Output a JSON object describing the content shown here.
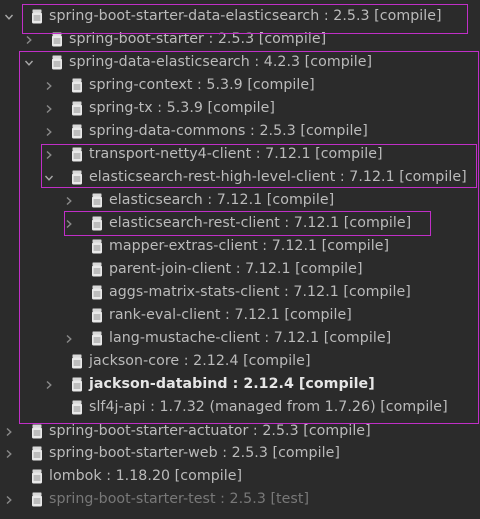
{
  "tree": [
    {
      "label": "spring-boot-starter-data-elasticsearch : 2.5.3 [compile]",
      "depth": 0,
      "arrow": "down",
      "style": "normal"
    },
    {
      "label": "spring-boot-starter : 2.5.3 [compile]",
      "depth": 1,
      "arrow": "right",
      "style": "normal"
    },
    {
      "label": "spring-data-elasticsearch : 4.2.3 [compile]",
      "depth": 1,
      "arrow": "down",
      "style": "normal"
    },
    {
      "label": "spring-context : 5.3.9 [compile]",
      "depth": 2,
      "arrow": "right",
      "style": "normal"
    },
    {
      "label": "spring-tx : 5.3.9 [compile]",
      "depth": 2,
      "arrow": "right",
      "style": "normal"
    },
    {
      "label": "spring-data-commons : 2.5.3 [compile]",
      "depth": 2,
      "arrow": "right",
      "style": "normal"
    },
    {
      "label": "transport-netty4-client : 7.12.1 [compile]",
      "depth": 2,
      "arrow": "right",
      "style": "normal"
    },
    {
      "label": "elasticsearch-rest-high-level-client : 7.12.1 [compile]",
      "depth": 2,
      "arrow": "down",
      "style": "normal"
    },
    {
      "label": "elasticsearch : 7.12.1 [compile]",
      "depth": 3,
      "arrow": "right",
      "style": "normal"
    },
    {
      "label": "elasticsearch-rest-client : 7.12.1 [compile]",
      "depth": 3,
      "arrow": "right",
      "style": "normal"
    },
    {
      "label": "mapper-extras-client : 7.12.1 [compile]",
      "depth": 3,
      "arrow": "none",
      "style": "normal"
    },
    {
      "label": "parent-join-client : 7.12.1 [compile]",
      "depth": 3,
      "arrow": "none",
      "style": "normal"
    },
    {
      "label": "aggs-matrix-stats-client : 7.12.1 [compile]",
      "depth": 3,
      "arrow": "none",
      "style": "normal"
    },
    {
      "label": "rank-eval-client : 7.12.1 [compile]",
      "depth": 3,
      "arrow": "none",
      "style": "normal"
    },
    {
      "label": "lang-mustache-client : 7.12.1 [compile]",
      "depth": 3,
      "arrow": "right",
      "style": "normal"
    },
    {
      "label": "jackson-core : 2.12.4 [compile]",
      "depth": 2,
      "arrow": "none",
      "style": "normal"
    },
    {
      "label": "jackson-databind : 2.12.4 [compile]",
      "depth": 2,
      "arrow": "right",
      "style": "bold"
    },
    {
      "label": "slf4j-api : 1.7.32 (managed from 1.7.26) [compile]",
      "depth": 2,
      "arrow": "none",
      "style": "normal"
    },
    {
      "label": "spring-boot-starter-actuator : 2.5.3 [compile]",
      "depth": 0,
      "arrow": "right",
      "style": "normal"
    },
    {
      "label": "spring-boot-starter-web : 2.5.3 [compile]",
      "depth": 0,
      "arrow": "right",
      "style": "normal"
    },
    {
      "label": "lombok : 1.18.20 [compile]",
      "depth": 0,
      "arrow": "none",
      "style": "normal"
    },
    {
      "label": "spring-boot-starter-test : 2.5.3 [test]",
      "depth": 0,
      "arrow": "right",
      "style": "dim"
    }
  ],
  "icons": {
    "expand": "chevron-down-icon",
    "collapse": "chevron-right-icon",
    "artifact": "jar-icon"
  },
  "colors": {
    "background": "#2b2b2b",
    "text": "#bbbbbb",
    "highlight_box": "#c02fc7",
    "dim_text": "#787878"
  }
}
